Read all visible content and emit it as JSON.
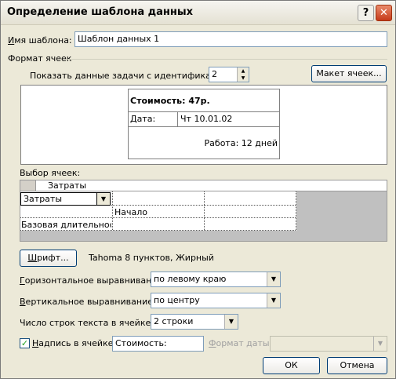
{
  "window": {
    "title": "Определение шаблона данных",
    "help_glyph": "?",
    "close_glyph": "✕"
  },
  "template_name": {
    "label": "Имя шаблона:",
    "value": "Шаблон данных 1"
  },
  "cell_format": {
    "label": "Формат ячеек",
    "show_data_label": "Показать данные задачи с идентификатором:",
    "task_id": "2",
    "layout_button": "Макет ячеек..."
  },
  "preview": {
    "cost": "Стоимость: 47р.",
    "date_label": "Дата:",
    "date_value": "Чт 10.01.02",
    "work": "Работа: 12 дней"
  },
  "cell_select": {
    "label": "Выбор ячеек:",
    "header_value": "Затраты",
    "rows": [
      [
        "Затраты",
        "",
        "",
        ""
      ],
      [
        "",
        "Начало",
        "",
        ""
      ],
      [
        "Базовая длительность",
        "",
        "",
        ""
      ]
    ]
  },
  "font": {
    "button": "Шрифт...",
    "value": "Tahoma 8 пунктов, Жирный"
  },
  "h_align": {
    "label": "Горизонтальное выравнивание:",
    "value": "по левому краю"
  },
  "v_align": {
    "label": "Вертикальное выравнивание:",
    "value": "по центру"
  },
  "line_count": {
    "label": "Число строк текста в ячейке:",
    "value": "2 строки"
  },
  "caption": {
    "label": "Надпись в ячейке:",
    "value": "Стоимость:",
    "checked": true
  },
  "date_format": {
    "label": "Формат даты:",
    "value": ""
  },
  "buttons": {
    "ok": "ОК",
    "cancel": "Отмена"
  },
  "colors": {
    "face": "#ece9d8",
    "accent_border": "#003c74",
    "grid_gray": "#c0c0c0"
  }
}
